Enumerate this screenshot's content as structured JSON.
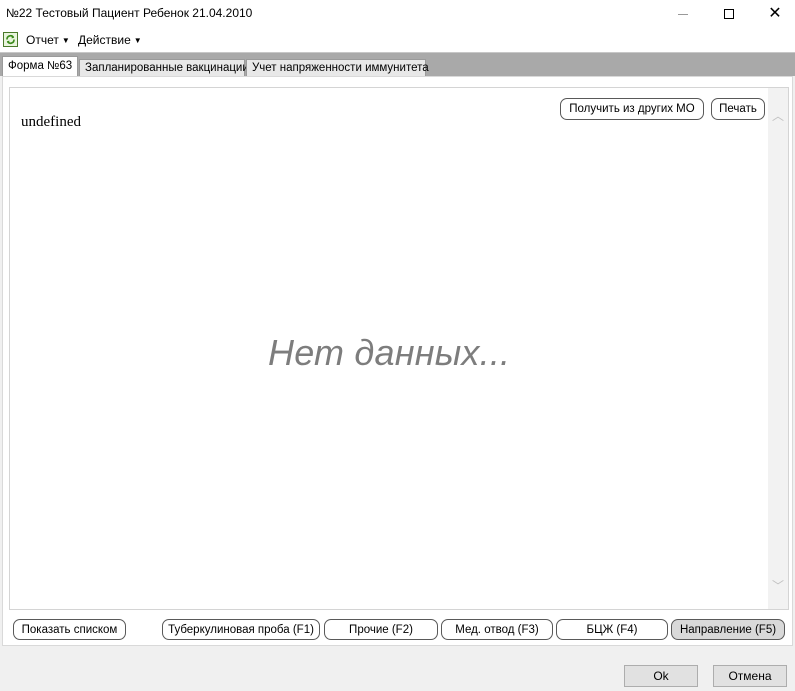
{
  "window": {
    "title": "№22 Тестовый Пациент Ребенок 21.04.2010"
  },
  "menu": {
    "items": [
      {
        "label": "Отчет"
      },
      {
        "label": "Действие"
      }
    ]
  },
  "tabs": [
    {
      "label": "Форма №63",
      "active": true
    },
    {
      "label": "Запланированные вакцинации",
      "active": false
    },
    {
      "label": "Учет напряженности иммунитета",
      "active": false
    }
  ],
  "panel": {
    "top_text": "undefined",
    "empty_message": "Нет данных...",
    "get_from_mo_label": "Получить из других МО",
    "print_label": "Печать"
  },
  "actions": {
    "show_list_label": "Показать списком",
    "tuberculin_label": "Туберкулиновая проба (F1)",
    "other_label": "Прочие (F2)",
    "med_exempt_label": "Мед. отвод (F3)",
    "bcg_label": "БЦЖ (F4)",
    "referral_label": "Направление (F5)"
  },
  "dialog": {
    "ok_label": "Ok",
    "cancel_label": "Отмена"
  },
  "colors": {
    "tabstrip_bg": "#a9a9a9",
    "empty_message": "#7d7d7d",
    "pressed_button": "#d9d9d9"
  },
  "icons": {
    "app": "refresh-document-icon",
    "minimize": "minimize-icon",
    "maximize": "maximize-icon",
    "close": "close-icon",
    "scroll_up": "chevron-up-icon",
    "scroll_down": "chevron-down-icon"
  }
}
